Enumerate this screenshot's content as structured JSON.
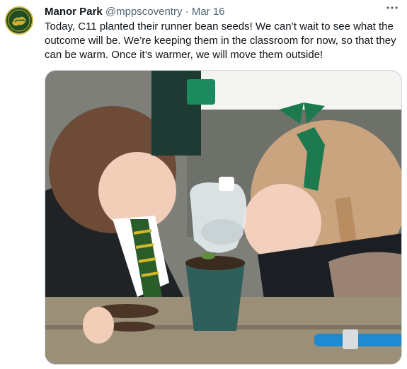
{
  "tweet": {
    "author_name": "Manor Park",
    "author_handle": "@mppscoventry",
    "separator": "·",
    "date": "Mar 16",
    "text": "Today, C11 planted their runner bean seeds! We can’t wait to see what the outcome will be. We’re keeping them in the classroom for now, so that they can be warm. Once it’s warmer, we will move them outside!"
  },
  "icons": {
    "avatar": "school-crest-logo",
    "more": "more-options-icon"
  },
  "photo": {
    "subject": "two children watering a plant pot with a jug"
  },
  "colors": {
    "text": "#0f1419",
    "secondary": "#536471",
    "avatar_bg": "#1f4d1f",
    "avatar_ring": "#c9b23a"
  }
}
